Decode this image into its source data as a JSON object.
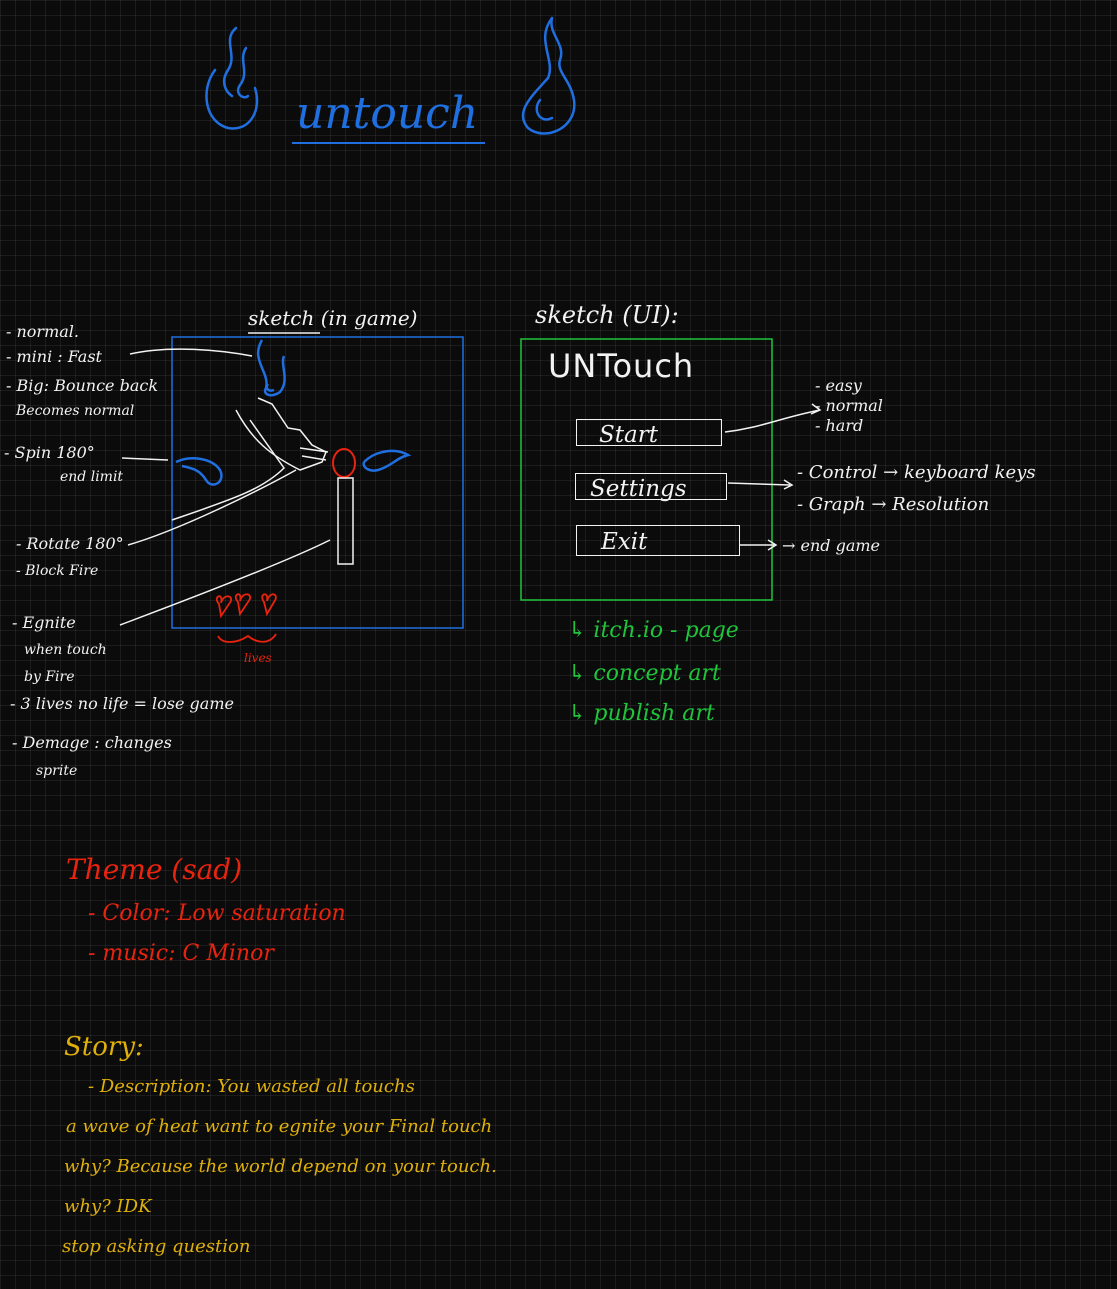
{
  "title": "untouch",
  "ingame_sketch": {
    "heading": "sketch (in game)",
    "lives_label": "lives",
    "notes": {
      "modes": [
        "- normal.",
        "- mini : Fast",
        "- Big: Bounce back",
        "Becomes normal"
      ],
      "spin": [
        "- Spin 180°",
        "end limit"
      ],
      "rotate": [
        "- Rotate 180°",
        "- Block Fire"
      ],
      "ignite": [
        "- Egnite",
        "when touch",
        "by Fire",
        "- 3 lives no life = lose game",
        "- Demage : changes",
        "sprite"
      ]
    }
  },
  "ui_sketch": {
    "heading": "sketch (UI):",
    "game_title": "UNTouch",
    "buttons": {
      "start": "Start",
      "settings": "Settings",
      "exit": "Exit"
    },
    "start_options": [
      "- easy",
      "- normal",
      "- hard"
    ],
    "settings_options": [
      "- Control → keyboard keys",
      "- Graph → Resolution"
    ],
    "exit_note": "→ end game"
  },
  "links": [
    "↳ itch.io - page",
    "↳ concept art",
    "↳ publish art"
  ],
  "theme": {
    "heading": "Theme (sad)",
    "items": [
      "- Color: Low saturation",
      "- music: C Minor"
    ]
  },
  "story": {
    "heading": "Story:",
    "lines": [
      "- Description: You wasted all touchs",
      "a wave of heat want to egnite your Final touch",
      "why? Because the world depend on your touch.",
      "why? IDK",
      "stop asking question"
    ]
  },
  "colors": {
    "background": "#0b0b0b",
    "ink_white": "#f2f2f2",
    "ink_blue": "#1f6fe0",
    "ink_red": "#e8230e",
    "ink_green": "#1fc43a",
    "ink_yellow": "#e0b00a"
  }
}
